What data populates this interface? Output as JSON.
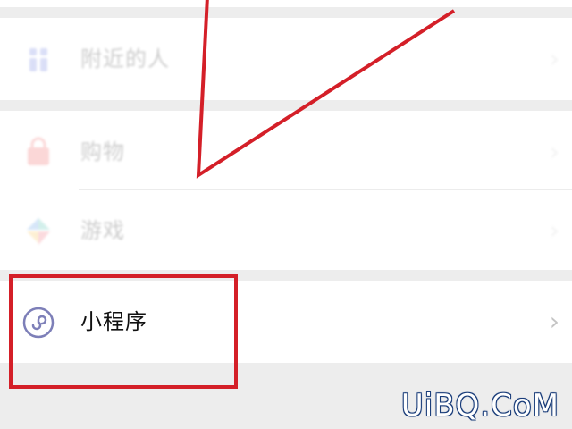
{
  "menu": {
    "items": [
      {
        "label": "附近的人",
        "icon": "people-nearby-icon",
        "color": "#5b6fdc"
      },
      {
        "label": "购物",
        "icon": "shopping-bag-icon",
        "color": "#ef4f4f"
      },
      {
        "label": "游戏",
        "icon": "game-icon",
        "color": "#38b9a6"
      },
      {
        "label": "小程序",
        "icon": "mini-program-icon",
        "color": "#7d7fb8"
      }
    ],
    "chevron": "›"
  },
  "annotation": {
    "highlight_color": "#d41f28"
  },
  "watermark": "UiBQ.CoM"
}
